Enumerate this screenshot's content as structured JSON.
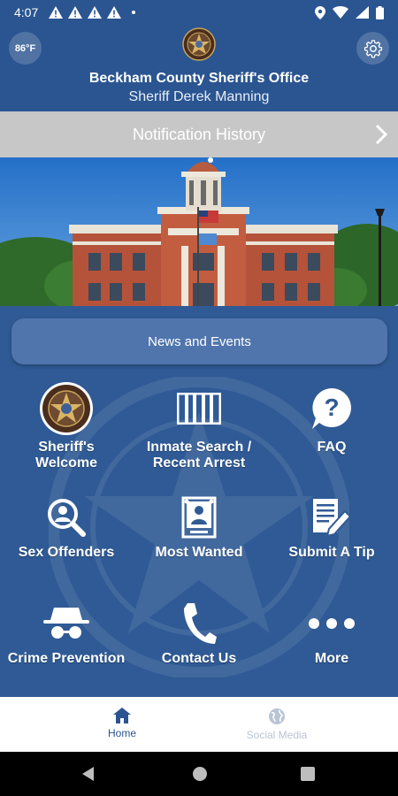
{
  "status_bar": {
    "time": "4:07"
  },
  "header": {
    "temperature": "86°F",
    "office_title": "Beckham County Sheriff's Office",
    "sheriff_name": "Sheriff Derek Manning"
  },
  "notification_bar": {
    "label": "Notification History"
  },
  "news_button": {
    "label": "News and Events"
  },
  "grid": [
    {
      "label": "Sheriff's Welcome",
      "icon": "sheriff-badge-icon"
    },
    {
      "label": "Inmate Search / Recent Arrest",
      "icon": "jail-bars-icon"
    },
    {
      "label": "FAQ",
      "icon": "question-icon"
    },
    {
      "label": "Sex Offenders",
      "icon": "magnify-person-icon"
    },
    {
      "label": "Most Wanted",
      "icon": "wanted-poster-icon"
    },
    {
      "label": "Submit A Tip",
      "icon": "document-pen-icon"
    },
    {
      "label": "Crime Prevention",
      "icon": "spy-icon"
    },
    {
      "label": "Contact Us",
      "icon": "phone-icon"
    },
    {
      "label": "More",
      "icon": "more-dots-icon"
    }
  ],
  "bottom_nav": {
    "home": "Home",
    "social": "Social Media"
  },
  "colors": {
    "primary": "#2a5591",
    "background": "#2f5a95",
    "notification_bar": "#c7c7c7",
    "news_button": "#5075ad"
  }
}
